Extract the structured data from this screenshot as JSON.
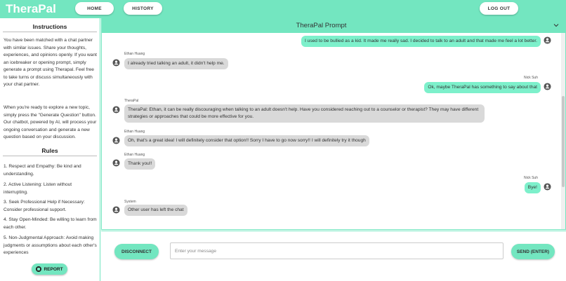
{
  "app": {
    "brand": "TheraPal"
  },
  "nav": {
    "home": "HOME",
    "history": "HISTORY",
    "logout": "LOG OUT"
  },
  "sidebar": {
    "instructions_title": "Instructions",
    "instructions_p1": "You have been matched with a chat partner with similar issues. Share your thoughts, experiences, and opinions openly. If you want an icebreaker or opening prompt, simply generate a prompt using Therapal. Feel free to take turns or discuss simultaneously with your chat partner.",
    "instructions_p2": "When you're ready to explore a new topic, simply press the \"Generate Question\" button. Our chatbot, powered by AI, will process your ongoing conversation and generate a new question based on your discussion.",
    "rules_title": "Rules",
    "rules": [
      "1. Respect and Empathy: Be kind and understanding.",
      "2. Active Listening: Listen without interrupting.",
      "3. Seek Professional Help if Necessary: Consider professional support.",
      "4. Stay Open-Minded: Be willing to learn from each other.",
      "5. Non-Judgmental Approach: Avoid making judgments or assumptions about each other's experiences"
    ],
    "report_label": "REPORT"
  },
  "chat": {
    "title": "TheraPal Prompt",
    "messages": [
      {
        "sender": "",
        "text": "I used to be bullied as a kid. It made me really sad. I decided to talk to an adult and that made me feel a lot better.",
        "side": "right"
      },
      {
        "sender": "Ethan Huang",
        "text": "I already tried talking an adult, it didn't help me.",
        "side": "left"
      },
      {
        "sender": "Nick Suh",
        "text": "Ok, maybe TheraPal has something to say about that",
        "side": "right"
      },
      {
        "sender": "TheraPal",
        "text": "TheraPal: Ethan, it can be really discouraging when talking to an adult doesn't help. Have you considered reaching out to a counselor or therapist? They may have different strategies or approaches that could be more effective for you.",
        "side": "left"
      },
      {
        "sender": "Ethan Huang",
        "text": "Oh, that's a great idea! I will definitely consider that option!! Sorry I have to go now sorry!! I will definitely try it though",
        "side": "left"
      },
      {
        "sender": "Ethan Huang",
        "text": "Thank you!!",
        "side": "left"
      },
      {
        "sender": "Nick Suh",
        "text": "Bye!",
        "side": "right"
      },
      {
        "sender": "System",
        "text": "Other user has left the chat",
        "side": "left"
      }
    ]
  },
  "composer": {
    "disconnect_label": "DISCONNECT",
    "placeholder": "Enter your message",
    "send_label": "SEND (ENTER)"
  },
  "colors": {
    "accent": "#73e6c0",
    "bubble_self": "#7df0cb",
    "bubble_other": "#d9d9d9"
  }
}
